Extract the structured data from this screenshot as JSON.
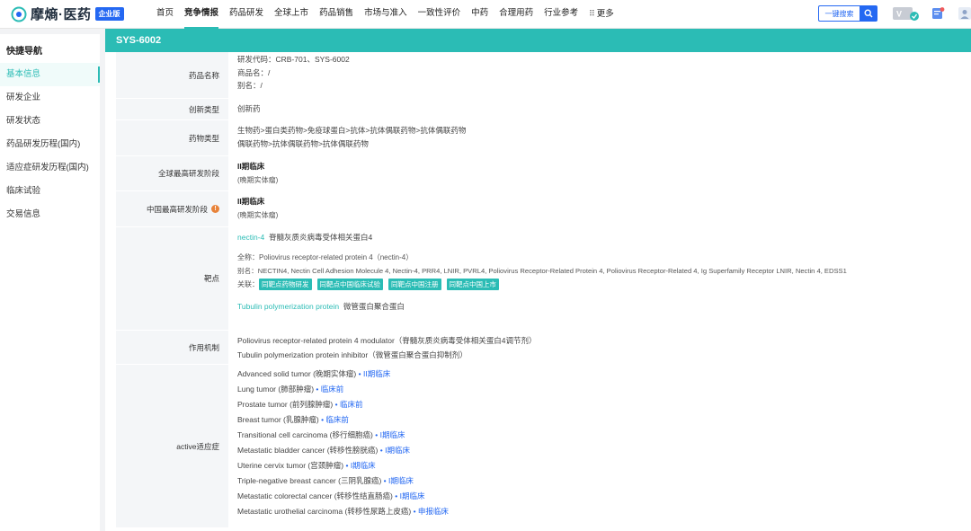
{
  "brand": {
    "name": "摩熵·医药",
    "badge": "企业版"
  },
  "nav": [
    {
      "label": "首页"
    },
    {
      "label": "竞争情报"
    },
    {
      "label": "药品研发"
    },
    {
      "label": "全球上市"
    },
    {
      "label": "药品销售"
    },
    {
      "label": "市场与准入"
    },
    {
      "label": "一致性评价"
    },
    {
      "label": "中药"
    },
    {
      "label": "合理用药"
    },
    {
      "label": "行业参考"
    },
    {
      "label": "更多"
    }
  ],
  "search": {
    "button_label": "一键搜索"
  },
  "sidebar": {
    "title": "快捷导航",
    "items": [
      {
        "label": "基本信息"
      },
      {
        "label": "研发企业"
      },
      {
        "label": "研发状态"
      },
      {
        "label": "药品研发历程(国内)"
      },
      {
        "label": "适应症研发历程(国内)"
      },
      {
        "label": "临床试验"
      },
      {
        "label": "交易信息"
      }
    ]
  },
  "drug": {
    "header": "SYS-6002",
    "name_label": "药品名称",
    "code_line": "研发代码：CRB-701、SYS-6002",
    "trade_name": "商品名：/",
    "alias": "别名：/",
    "innovation_label": "创新类型",
    "innovation_value": "创新药",
    "drug_type_label": "药物类型",
    "drug_type_line1": "生物药>蛋白类药物>免疫球蛋白>抗体>抗体偶联药物>抗体偶联药物",
    "drug_type_line2": "偶联药物>抗体偶联药物>抗体偶联药物",
    "global_stage_label": "全球最高研发阶段",
    "global_stage": "II期临床",
    "global_stage_sub": "(晚期实体瘤)",
    "china_stage_label": "中国最高研发阶段",
    "china_stage": "II期临床",
    "china_stage_sub": "(晚期实体瘤)",
    "target_label": "靶点",
    "target1_name": "nectin-4",
    "target1_cn": "脊髓灰质炎病毒受体相关蛋白4",
    "target1_fullname": "全称：Poliovirus receptor-related protein 4（nectin-4）",
    "target1_alias": "别名：NECTIN4, Nectin Cell Adhesion Molecule 4, Nectin-4, PRR4, LNIR, PVRL4, Poliovirus Receptor-Related Protein 4, Poliovirus Receptor-Related 4, Ig Superfamily Receptor LNIR, Nectin 4, EDSS1",
    "related_label": "关联：",
    "related_tags": [
      "同靶点药物研发",
      "同靶点中国临床试验",
      "同靶点中国注册",
      "同靶点中国上市"
    ],
    "target2_name": "Tubulin polymerization protein",
    "target2_cn": "微管蛋白聚合蛋白",
    "moa_label": "作用机制",
    "moa1": "Poliovirus receptor-related protein 4 modulator（脊髓灰质炎病毒受体相关蛋白4调节剂）",
    "moa2": "Tubulin polymerization protein inhibitor（微管蛋白聚合蛋白抑制剂）",
    "indication_label": "active适应症",
    "indications": [
      {
        "name": "Advanced solid tumor (晚期实体瘤)",
        "stage": "II期临床"
      },
      {
        "name": "Lung tumor (肺部肿瘤)",
        "stage": "临床前"
      },
      {
        "name": "Prostate tumor (前列腺肿瘤)",
        "stage": "临床前"
      },
      {
        "name": "Breast tumor (乳腺肿瘤)",
        "stage": "临床前"
      },
      {
        "name": "Transitional cell carcinoma (移行细胞癌)",
        "stage": "I期临床"
      },
      {
        "name": "Metastatic bladder cancer (转移性膀胱癌)",
        "stage": "I期临床"
      },
      {
        "name": "Uterine cervix tumor (宫颈肿瘤)",
        "stage": "I期临床"
      },
      {
        "name": "Triple-negative breast cancer (三阴乳腺癌)",
        "stage": "I期临床"
      },
      {
        "name": "Metastatic colorectal cancer (转移性结直肠癌)",
        "stage": "I期临床"
      },
      {
        "name": "Metastatic urothelial carcinoma (转移性尿路上皮癌)",
        "stage": "申报临床"
      }
    ]
  },
  "colors": {
    "accent": "#2bbcb5",
    "link": "#2468f2",
    "warn": "#e8833a"
  }
}
